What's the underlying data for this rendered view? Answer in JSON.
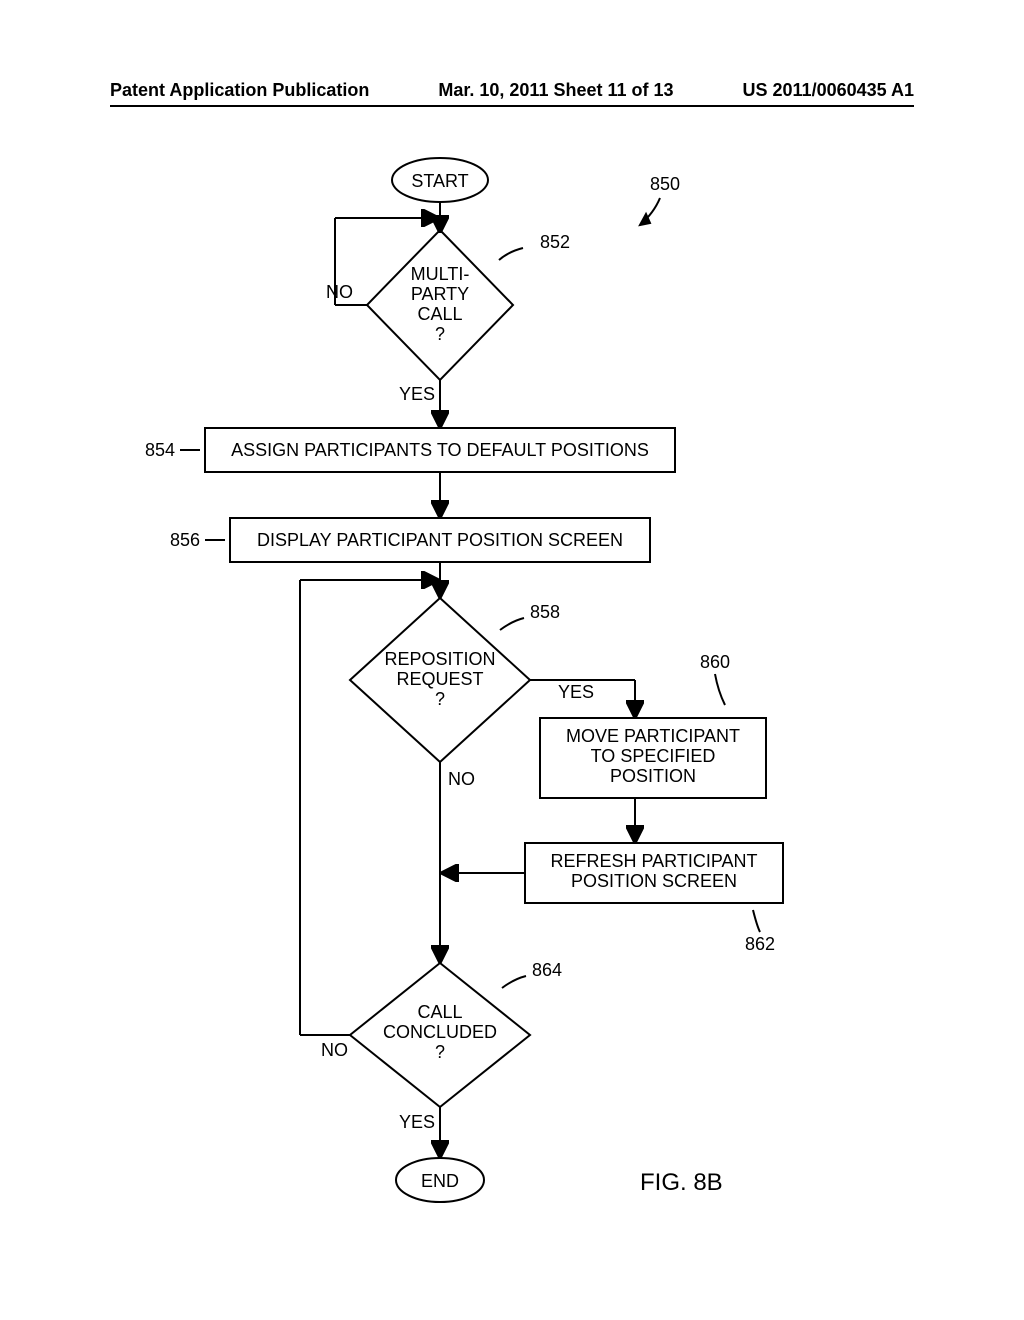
{
  "header": {
    "left": "Patent Application Publication",
    "center": "Mar. 10, 2011  Sheet 11 of 13",
    "right": "US 2011/0060435 A1"
  },
  "figure_label": "FIG. 8B",
  "ref_overall": "850",
  "chart_data": {
    "type": "flowchart",
    "nodes": [
      {
        "id": "start",
        "kind": "terminator",
        "text": "START"
      },
      {
        "id": "d852",
        "kind": "decision",
        "ref": "852",
        "text": "MULTI-PARTY CALL ?",
        "yes_to": "p854",
        "no_to": "d852"
      },
      {
        "id": "p854",
        "kind": "process",
        "ref": "854",
        "text": "ASSIGN PARTICIPANTS TO DEFAULT POSITIONS"
      },
      {
        "id": "p856",
        "kind": "process",
        "ref": "856",
        "text": "DISPLAY PARTICIPANT POSITION SCREEN"
      },
      {
        "id": "d858",
        "kind": "decision",
        "ref": "858",
        "text": "REPOSITION REQUEST ?",
        "yes_to": "p860",
        "no_to": "d864"
      },
      {
        "id": "p860",
        "kind": "process",
        "ref": "860",
        "text": "MOVE PARTICIPANT TO SPECIFIED POSITION"
      },
      {
        "id": "p862",
        "kind": "process",
        "ref": "862",
        "text": "REFRESH PARTICIPANT POSITION SCREEN"
      },
      {
        "id": "d864",
        "kind": "decision",
        "ref": "864",
        "text": "CALL CONCLUDED ?",
        "yes_to": "end",
        "no_to": "d858"
      },
      {
        "id": "end",
        "kind": "terminator",
        "text": "END"
      }
    ],
    "edges": [
      {
        "from": "start",
        "to": "d852"
      },
      {
        "from": "d852",
        "to": "p854",
        "label": "YES"
      },
      {
        "from": "d852",
        "to": "d852",
        "label": "NO"
      },
      {
        "from": "p854",
        "to": "p856"
      },
      {
        "from": "p856",
        "to": "d858"
      },
      {
        "from": "d858",
        "to": "p860",
        "label": "YES"
      },
      {
        "from": "p860",
        "to": "p862"
      },
      {
        "from": "p862",
        "to": "d864"
      },
      {
        "from": "d858",
        "to": "d864",
        "label": "NO"
      },
      {
        "from": "d864",
        "to": "end",
        "label": "YES"
      },
      {
        "from": "d864",
        "to": "d858",
        "label": "NO"
      }
    ]
  },
  "labels": {
    "start": "START",
    "end": "END",
    "yes": "YES",
    "no": "NO",
    "d852_l1": "MULTI-",
    "d852_l2": "PARTY",
    "d852_l3": "CALL",
    "d852_l4": "?",
    "p854": "ASSIGN PARTICIPANTS TO DEFAULT POSITIONS",
    "p856": "DISPLAY PARTICIPANT POSITION SCREEN",
    "d858_l1": "REPOSITION",
    "d858_l2": "REQUEST",
    "d858_l3": "?",
    "p860_l1": "MOVE PARTICIPANT",
    "p860_l2": "TO SPECIFIED",
    "p860_l3": "POSITION",
    "p862_l1": "REFRESH PARTICIPANT",
    "p862_l2": "POSITION SCREEN",
    "d864_l1": "CALL",
    "d864_l2": "CONCLUDED",
    "d864_l3": "?",
    "r850": "850",
    "r852": "852",
    "r854": "854",
    "r856": "856",
    "r858": "858",
    "r860": "860",
    "r862": "862",
    "r864": "864"
  }
}
